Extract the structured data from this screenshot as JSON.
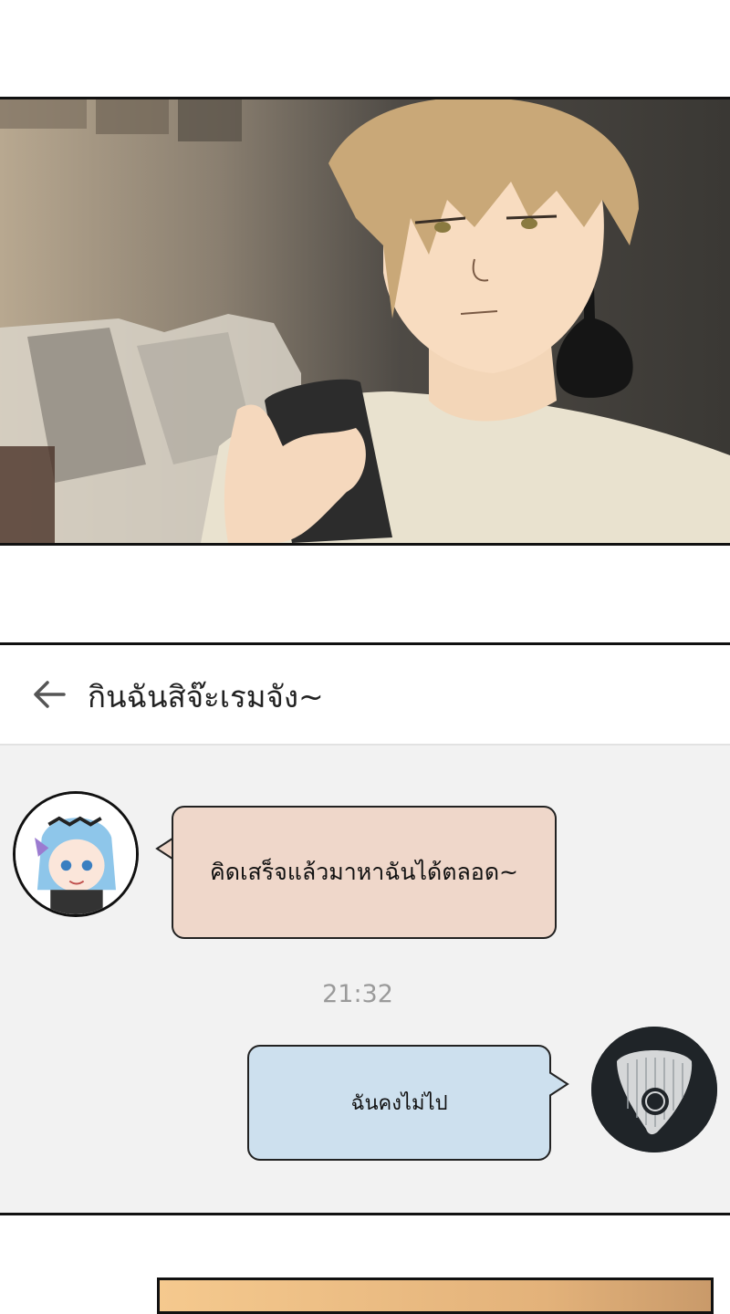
{
  "chat": {
    "title": "กินฉันสิจ๊ะเรมจัง~",
    "messages": [
      {
        "side": "left",
        "text": "คิดเสร็จแล้วมาหาฉันได้ตลอด~"
      },
      {
        "side": "right",
        "text": "ฉันคงไม่ไป"
      }
    ],
    "timestamp": "21:32"
  },
  "colors": {
    "incoming_bubble": "#efd7ca",
    "outgoing_bubble": "#cde0ee",
    "chat_background": "#f2f2f2"
  },
  "icons": {
    "back": "arrow-left-icon",
    "left_avatar": "anime-girl-avatar",
    "right_avatar": "guitar-pick-avatar"
  }
}
